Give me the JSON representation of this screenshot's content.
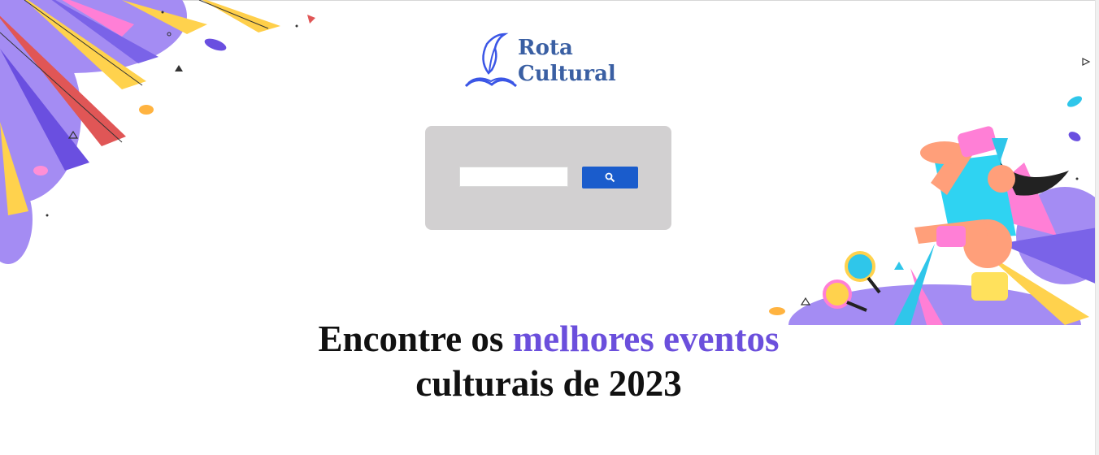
{
  "logo": {
    "line1": "Rota",
    "line2": "Cultural",
    "icon": "quill-book-icon"
  },
  "search": {
    "value": "",
    "placeholder": "",
    "button_icon": "search-icon"
  },
  "headline": {
    "part1": "Encontre os ",
    "highlight": "melhores eventos",
    "line2": "culturais de 2023"
  },
  "colors": {
    "accent": "#6b4fdc",
    "logo": "#3a5fa3",
    "search_button": "#1a5ccc",
    "search_panel": "#d2d0d1"
  }
}
